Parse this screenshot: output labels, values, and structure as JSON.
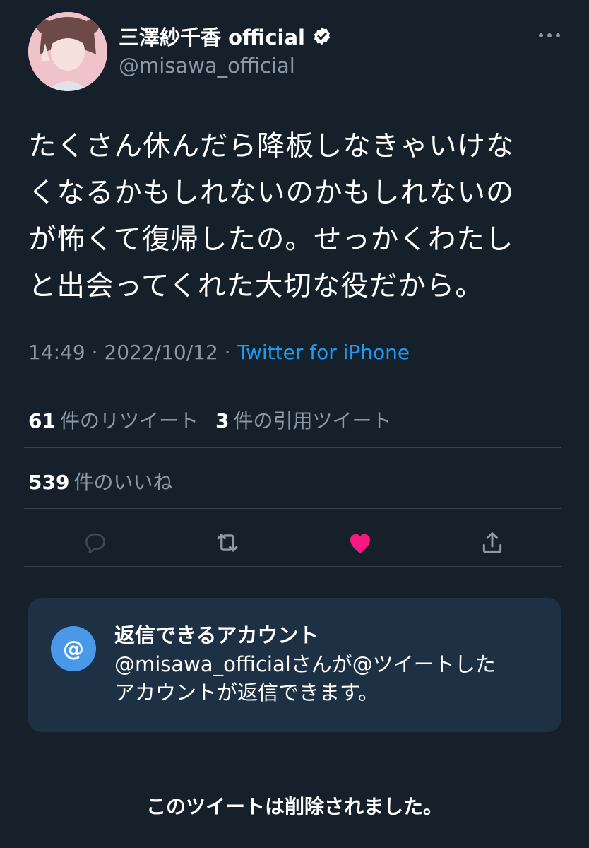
{
  "author": {
    "display_name": "三澤紗千香 official",
    "handle": "@misawa_official",
    "verified": true
  },
  "tweet": {
    "text": "たくさん休んだら降板しなきゃいけな\nくなるかもしれないのかもしれないの\nが怖くて復帰したの。せっかくわたし\nと出会ってくれた大切な役だから。",
    "time": "14:49",
    "separator": " · ",
    "date": "2022/10/12",
    "source": "Twitter for iPhone"
  },
  "stats": {
    "retweets_count": "61",
    "retweets_label": "件のリツイート",
    "quotes_count": "3",
    "quotes_label": "件の引用ツイート",
    "likes_count": "539",
    "likes_label": "件のいいね"
  },
  "actions": {
    "reply_icon": "reply-icon",
    "retweet_icon": "retweet-icon",
    "like_icon": "heart-icon",
    "share_icon": "share-icon",
    "liked": true
  },
  "reply_restriction": {
    "badge": "@",
    "title": "返信できるアカウント",
    "body": "@misawa_officialさんが@ツイートした\nアカウントが返信できます。"
  },
  "notice": "このツイートは削除されました。",
  "colors": {
    "background": "#15202b",
    "accent": "#1d9bf0",
    "like": "#f91880",
    "muted": "#8b98a5",
    "card": "#1e3144"
  }
}
